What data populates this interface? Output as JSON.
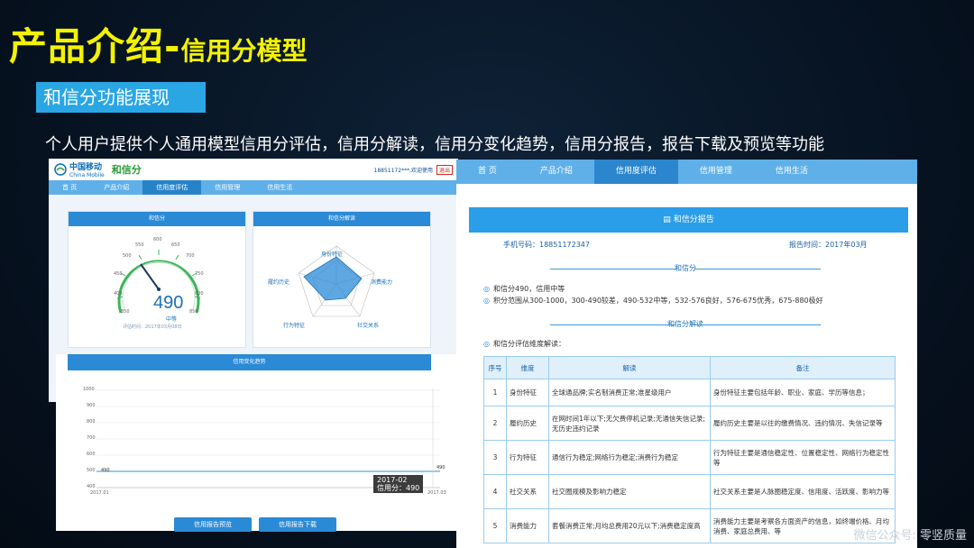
{
  "slide": {
    "title_main": "产品介绍-",
    "title_sub": "信用分模型",
    "section_label": "和信分功能展现",
    "description": "个人用户提供个人通用模型信用分评估，信用分解读，信用分变化趋势，信用分报告，报告下载及预览等功能",
    "watermark": "微信公众号: 零竖质量"
  },
  "left_app": {
    "brand_cm": "中国移动",
    "brand_cm_en": "China Mobile",
    "brand_hx": "和信分",
    "user_text": "18851172***,欢迎使用",
    "logout": "退出",
    "nav": [
      "首 页",
      "产品介绍",
      "信用度评估",
      "信用管理",
      "信用生活"
    ],
    "nav_active": 2,
    "score_panel": {
      "title": "和信分",
      "score": "490",
      "level": "中等",
      "eval_time": "评估时间：2017年03月08日",
      "ticks": [
        "350",
        "400",
        "450",
        "500",
        "550",
        "600",
        "650",
        "700",
        "750",
        "800",
        "850"
      ]
    },
    "radar_panel": {
      "title": "和信分解读",
      "labels": [
        "身份特征",
        "消费能力",
        "社交关系",
        "行为特征",
        "履约历史"
      ]
    },
    "trend_panel": {
      "title": "信用变化趋势",
      "yticks": [
        "1000",
        "900",
        "800",
        "700",
        "600",
        "500",
        "400"
      ],
      "x_start": "2017.01",
      "x_end": "2017.03",
      "left_value": "490",
      "right_value": "490",
      "tooltip_date": "2017-02",
      "tooltip_value": "信用分：490"
    },
    "buttons": [
      "信用报告预览",
      "信用报告下载"
    ]
  },
  "right_app": {
    "nav": [
      "首 页",
      "产品介绍",
      "信用度评估",
      "信用管理",
      "信用生活"
    ],
    "nav_active": 2,
    "report_title": "和信分报告",
    "phone": "手机号码：18851172347",
    "report_time": "报告时间：2017年03月",
    "section1": "和信分",
    "bullets1": [
      "和信分490，信用中等",
      "积分范围从300-1000，300-490较差，490-532中等，532-576良好，576-675优秀，675-880极好"
    ],
    "section2": "和信分解读",
    "bullets2": [
      "和信分评估维度解读："
    ],
    "table": {
      "headers": [
        "序号",
        "维度",
        "解读",
        "备注"
      ],
      "rows": [
        [
          "1",
          "身份特征",
          "全球通品牌;实名制消费正常;准星级用户",
          "身份特征主要包括年龄、职业、家庭、学历等信息；"
        ],
        [
          "2",
          "履约历史",
          "在网时间1年以下;无欠费停机记录;无通信失信记录;无历史违约记录",
          "履约历史主要是以往的缴费情况、违约情况、失信记录等"
        ],
        [
          "3",
          "行为特征",
          "通信行为稳定;网络行为稳定;消费行为稳定",
          "行为特征主要是通信稳定性、位置稳定性、网络行为稳定性等"
        ],
        [
          "4",
          "社交关系",
          "社交圈规模及影响力稳定",
          "社交关系主要是人脉圈稳定度、信用度、活跃度、影响力等"
        ],
        [
          "5",
          "消费能力",
          "套餐消费正常;月均总费用20元以下;消费稳定度高",
          "消费能力主要是考察各方面资产的信息，如终端价格、月均消费、家庭总费用、等"
        ]
      ]
    }
  }
}
